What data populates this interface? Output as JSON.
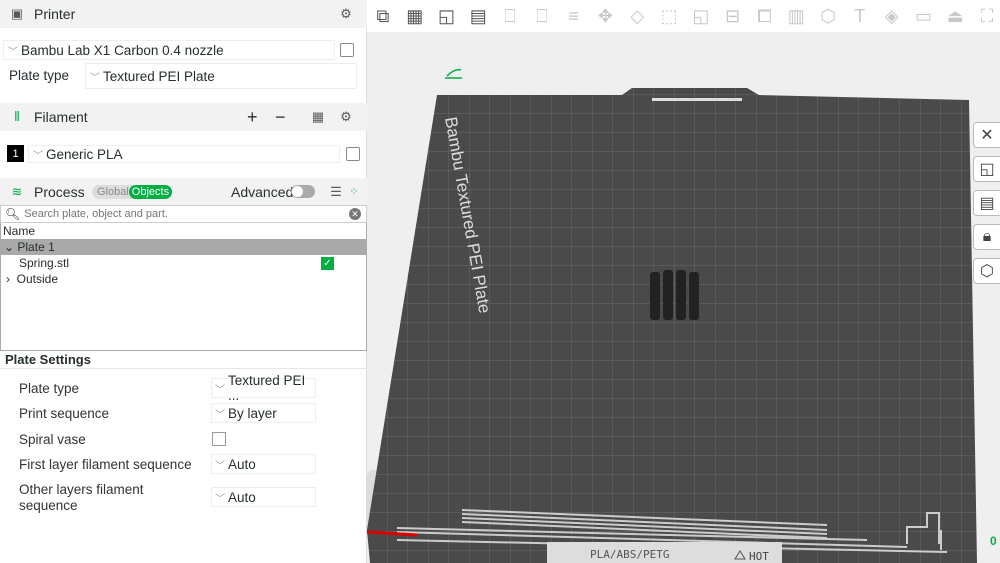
{
  "printer": {
    "title": "Printer",
    "preset": "Bambu Lab X1 Carbon 0.4 nozzle",
    "plate_type_label": "Plate type",
    "plate_type": "Textured PEI Plate"
  },
  "filament": {
    "title": "Filament",
    "add": "+",
    "remove": "−",
    "items": [
      {
        "index": "1",
        "name": "Generic PLA",
        "color": "#000000"
      }
    ]
  },
  "process": {
    "title": "Process",
    "global": "Global",
    "objects": "Objects",
    "advanced": "Advanced",
    "advanced_on": false
  },
  "search": {
    "placeholder": "Search plate, object and part."
  },
  "tree": {
    "header": "Name",
    "plate": "Plate 1",
    "object": "Spring.stl",
    "outside": "Outside"
  },
  "plate_settings": {
    "title": "Plate Settings",
    "rows": [
      {
        "label": "Plate type",
        "value": "Textured PEI ..."
      },
      {
        "label": "Print sequence",
        "value": "By layer"
      },
      {
        "label": "Spiral vase",
        "checked": false
      },
      {
        "label": "First layer filament sequence",
        "value": "Auto"
      },
      {
        "label": "Other layers filament sequence",
        "value": "Auto"
      }
    ]
  },
  "viewport": {
    "bed_label": "Bambu Textured PEI Plate",
    "bed_footer": "PLA/ABS/PETG",
    "hot": "HOT",
    "axis_label": "0"
  },
  "colors": {
    "accent": "#00ae42",
    "bed": "#4a4a4a"
  }
}
